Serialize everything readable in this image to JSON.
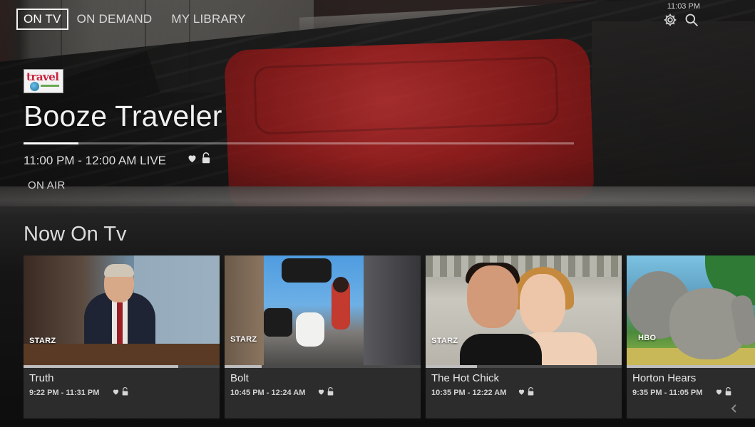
{
  "nav": {
    "tabs": [
      {
        "label": "ON TV",
        "active": true
      },
      {
        "label": "ON DEMAND",
        "active": false
      },
      {
        "label": "MY LIBRARY",
        "active": false
      }
    ]
  },
  "status_bar": {
    "time": "11:03 PM",
    "icons": [
      "gear-icon",
      "search-icon"
    ]
  },
  "hero": {
    "channel_logo_text": "travel",
    "title": "Booze Traveler",
    "time_range": "11:00 PM - 12:00 AM LIVE",
    "status": "ON AIR",
    "progress": 0.1,
    "icons": [
      "heart-icon",
      "lock-icon"
    ]
  },
  "section": {
    "title": "Now On Tv"
  },
  "cards": [
    {
      "title": "Truth",
      "time": "9:22 PM - 11:31 PM",
      "network": "STARZ",
      "progress": 0.79
    },
    {
      "title": "Bolt",
      "time": "10:45 PM - 12:24 AM",
      "network": "STARZ",
      "progress": 0.19
    },
    {
      "title": "The Hot Chick",
      "time": "10:35 PM - 12:22 AM",
      "network": "STARZ",
      "progress": 0.26
    },
    {
      "title": "Horton Hears",
      "time": "9:35 PM - 11:05 PM",
      "network": "HBO",
      "progress": 1.0
    }
  ],
  "colors": {
    "background": "#0c0c0c",
    "card": "#2c2c2c",
    "accent_text": "#f1f1f1",
    "suitcase_red": "#c62424"
  }
}
